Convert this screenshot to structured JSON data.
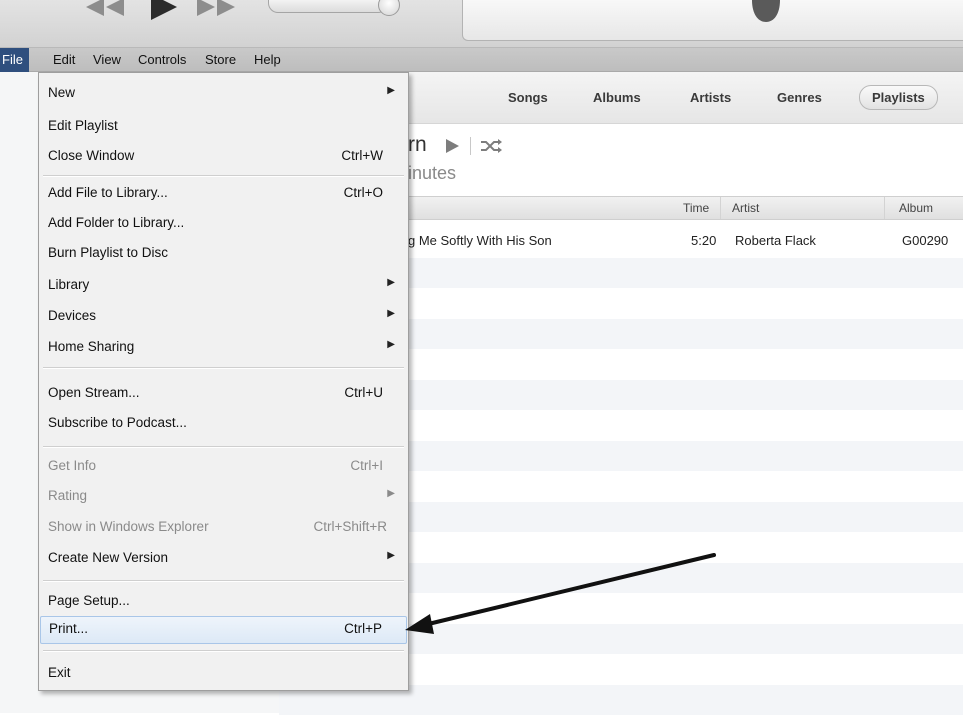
{
  "player": {
    "prev_icon": "rewind-icon",
    "play_icon": "play-icon",
    "next_icon": "fast-forward-icon",
    "logo_icon": "apple-logo-icon"
  },
  "menubar": {
    "file": "File",
    "edit": "Edit",
    "view": "View",
    "controls": "Controls",
    "store": "Store",
    "help": "Help"
  },
  "file_menu": {
    "new": {
      "label": "New"
    },
    "edit_playlist": {
      "label": "Edit Playlist"
    },
    "close_window": {
      "label": "Close Window",
      "shortcut": "Ctrl+W"
    },
    "add_file": {
      "label": "Add File to Library...",
      "shortcut": "Ctrl+O"
    },
    "add_folder": {
      "label": "Add Folder to Library..."
    },
    "burn": {
      "label": "Burn Playlist to Disc"
    },
    "library": {
      "label": "Library"
    },
    "devices": {
      "label": "Devices"
    },
    "home_sharing": {
      "label": "Home Sharing"
    },
    "open_stream": {
      "label": "Open Stream...",
      "shortcut": "Ctrl+U"
    },
    "subscribe": {
      "label": "Subscribe to Podcast..."
    },
    "get_info": {
      "label": "Get Info",
      "shortcut": "Ctrl+I"
    },
    "rating": {
      "label": "Rating"
    },
    "show_explorer": {
      "label": "Show in Windows Explorer",
      "shortcut": "Ctrl+Shift+R"
    },
    "create_version": {
      "label": "Create New Version"
    },
    "page_setup": {
      "label": "Page Setup..."
    },
    "print": {
      "label": "Print...",
      "shortcut": "Ctrl+P"
    },
    "exit": {
      "label": "Exit"
    }
  },
  "tabs": {
    "songs": "Songs",
    "albums": "Albums",
    "artists": "Artists",
    "genres": "Genres",
    "playlists": "Playlists"
  },
  "playlist": {
    "title_fragment": "rn",
    "subtitle_fragment": "inutes"
  },
  "columns": {
    "time": "Time",
    "artist": "Artist",
    "album": "Album"
  },
  "song": {
    "name": "g Me Softly With His Son",
    "time": "5:20",
    "artist": "Roberta Flack",
    "album": "G00290"
  },
  "colors": {
    "menu_active": "#2f4f7e",
    "hover_border": "#a9c6e8",
    "annotation_arrow": "#111111"
  }
}
